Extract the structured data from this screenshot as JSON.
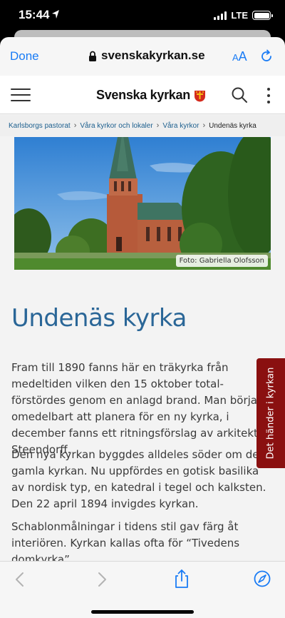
{
  "status_bar": {
    "time": "15:44",
    "network": "LTE"
  },
  "browser": {
    "done_label": "Done",
    "url": "svenskakyrkan.se",
    "text_size_small": "A",
    "text_size_big": "A"
  },
  "site": {
    "brand": "Svenska kyrkan"
  },
  "breadcrumb": {
    "items": [
      "Karlsborgs pastorat",
      "Våra kyrkor och lokaler",
      "Våra kyrkor"
    ],
    "current": "Undenäs kyrka"
  },
  "hero": {
    "credit": "Foto: Gabriella Olofsson"
  },
  "article": {
    "title": "Undenäs kyrka",
    "paragraphs": [
      "Fram till 1890 fanns här en träkyrka från medeltiden vilken den 15 oktober total-förstördes genom en anlagd brand. Man började omedelbart att planera för en ny kyrka, i december fanns ett ritningsförslag av arkitekt Steendorff.",
      "Den nya kyrkan byggdes alldeles söder om den gamla kyrkan. Nu uppfördes en gotisk basilika av nordisk typ, en katedral i tegel och kalksten. Den 22 april 1894 invigdes kyrkan.",
      "Schablonmålningar i tidens stil gav färg åt interiören. Kyrkan kallas ofta för “Tivedens domkyrka”."
    ]
  },
  "side_tab": {
    "label": "Det händer i kyrkan"
  },
  "colors": {
    "accent": "#1a7cf5",
    "title": "#2a6697",
    "side_tab": "#8a1010",
    "link": "#1c5f8e"
  }
}
